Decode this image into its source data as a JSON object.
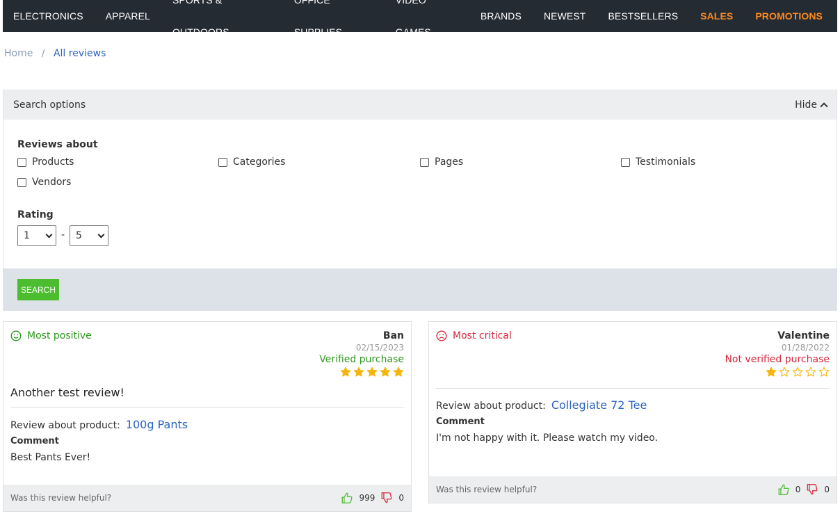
{
  "nav": {
    "items": [
      {
        "label": "ELECTRONICS"
      },
      {
        "label": "APPAREL"
      },
      {
        "label": "SPORTS & OUTDOORS"
      },
      {
        "label": "OFFICE SUPPLIES"
      },
      {
        "label": "VIDEO GAMES"
      },
      {
        "label": "BRANDS"
      },
      {
        "label": "NEWEST"
      },
      {
        "label": "BESTSELLERS"
      },
      {
        "label": "SALES"
      },
      {
        "label": "PROMOTIONS"
      }
    ],
    "accent_color": "#ff8a1c"
  },
  "breadcrumb": {
    "home": "Home",
    "separator": "/",
    "current": "All reviews"
  },
  "search": {
    "title": "Search options",
    "hide_label": "Hide",
    "reviews_about_label": "Reviews about",
    "checkboxes": [
      {
        "label": "Products",
        "checked": false
      },
      {
        "label": "Categories",
        "checked": false
      },
      {
        "label": "Pages",
        "checked": false
      },
      {
        "label": "Testimonials",
        "checked": false
      },
      {
        "label": "Vendors",
        "checked": false
      }
    ],
    "rating_label": "Rating",
    "rating_from": "1",
    "rating_separator": "-",
    "rating_to": "5",
    "button_label": "SEARCH",
    "button_color": "#4cbd2e"
  },
  "reviews": [
    {
      "kind": "Most positive",
      "kind_icon": "smile-icon",
      "author": "Ban",
      "date": "02/15/2023",
      "purchase_status": "Verified purchase",
      "rating": 5,
      "title": "Another test review!",
      "about_label": "Review about product:",
      "product": "100g Pants",
      "comment_label": "Comment",
      "comment": "Best Pants Ever!",
      "helpful_label": "Was this review helpful?",
      "likes": "999",
      "dislikes": "0"
    },
    {
      "kind": "Most critical",
      "kind_icon": "frown-icon",
      "author": "Valentine",
      "date": "01/28/2022",
      "purchase_status": "Not verified purchase",
      "rating": 1,
      "about_label": "Review about product:",
      "product": "Collegiate 72 Tee",
      "comment_label": "Comment",
      "comment": "I'm not happy with it. Please watch my video.",
      "helpful_label": "Was this review helpful?",
      "likes": "0",
      "dislikes": "0"
    }
  ]
}
